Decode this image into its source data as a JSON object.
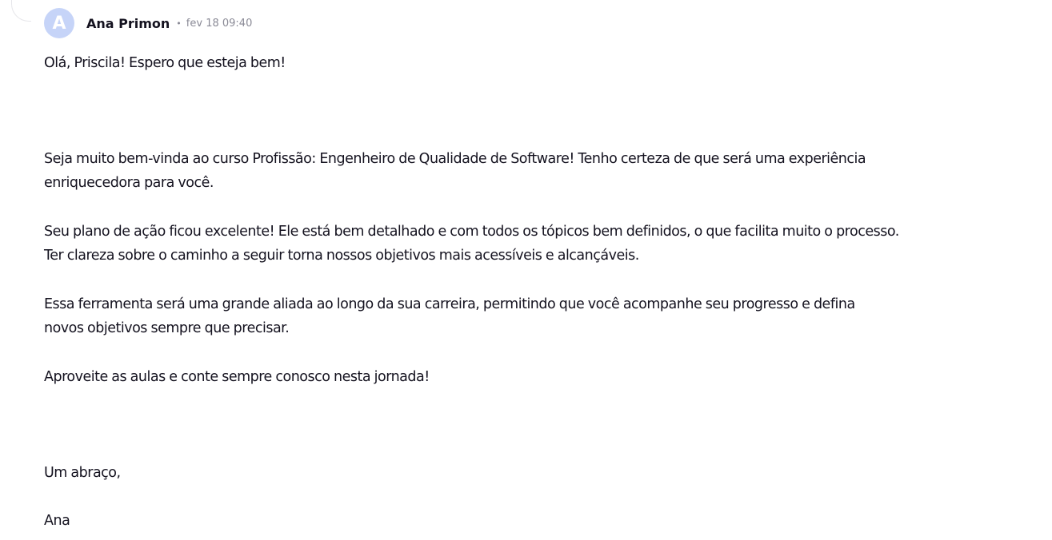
{
  "comment": {
    "avatar_letter": "A",
    "author": "Ana Primon",
    "separator": "•",
    "timestamp": "fev 18 09:40",
    "greeting": "Olá, Priscila! Espero que esteja bem!",
    "p1_line1": "Seja muito bem-vinda ao curso Profissão: Engenheiro de Qualidade de Software! Tenho certeza de que será uma experiência",
    "p1_line2": "enriquecedora para você.",
    "p2_line1": "Seu plano de ação ficou excelente! Ele está bem detalhado e com todos os tópicos bem definidos, o que facilita muito o processo.",
    "p2_line2": "Ter clareza sobre o caminho a seguir torna nossos objetivos mais acessíveis e alcançáveis.",
    "p3_line1": "Essa ferramenta será uma grande aliada ao longo da sua carreira, permitindo que você acompanhe seu progresso e defina",
    "p3_line2": "novos objetivos sempre que precisar.",
    "p4": "Aproveite as aulas e conte sempre conosco nesta jornada!",
    "closing": "Um abraço,",
    "signature": "Ana"
  },
  "colors": {
    "avatar_bg": "#c6d4f8",
    "text": "#14121f",
    "muted": "#8a8a96"
  }
}
